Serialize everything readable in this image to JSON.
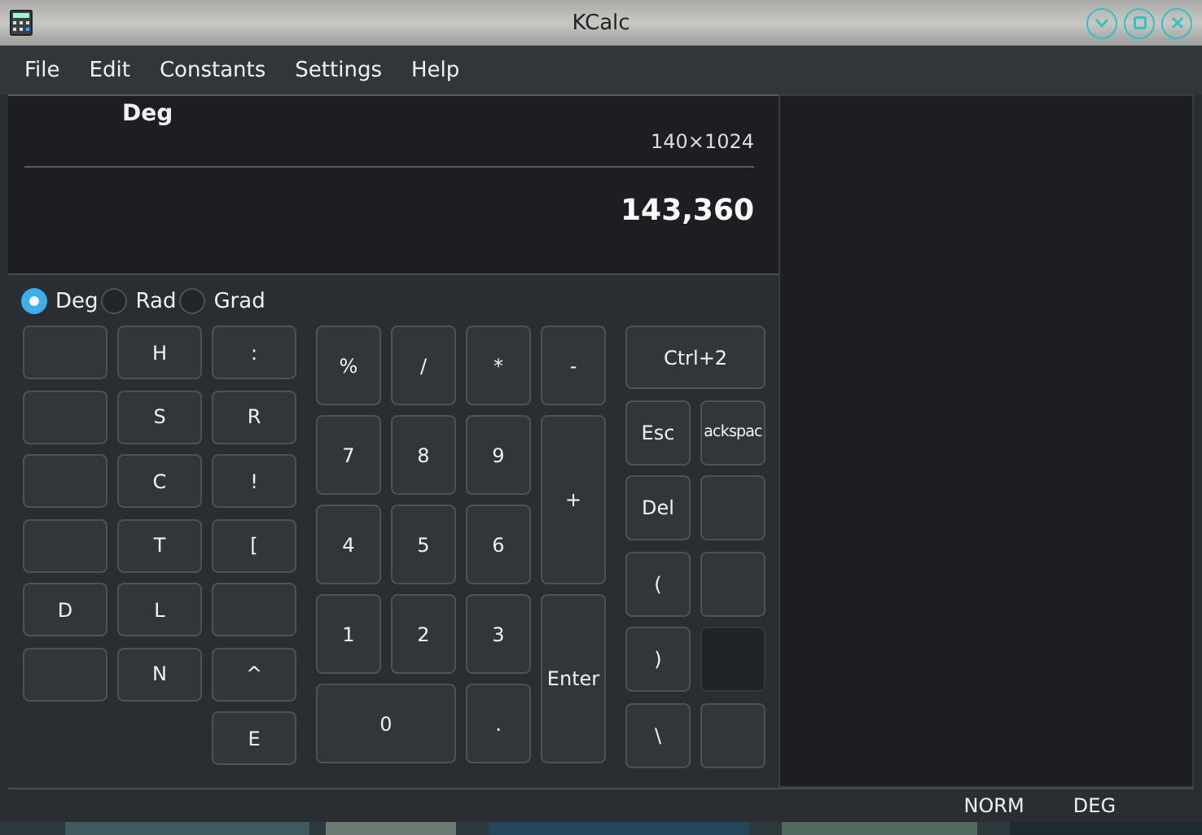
{
  "window": {
    "title": "KCalc"
  },
  "menu": [
    "File",
    "Edit",
    "Constants",
    "Settings",
    "Help"
  ],
  "display": {
    "angle_mode": "Deg",
    "history": "140×1024",
    "result": "143,360"
  },
  "angle_options": [
    {
      "label": "Deg",
      "selected": true
    },
    {
      "label": "Rad",
      "selected": false
    },
    {
      "label": "Grad",
      "selected": false
    }
  ],
  "function_columns": [
    {
      "keys": [
        {
          "kind": "blank"
        },
        {
          "kind": "blank"
        },
        {
          "kind": "blank"
        },
        {
          "kind": "blank"
        },
        {
          "kind": "normal",
          "label": "D"
        },
        {
          "kind": "blank"
        }
      ]
    },
    {
      "keys": [
        {
          "kind": "normal",
          "label": "H"
        },
        {
          "kind": "normal",
          "label": "S"
        },
        {
          "kind": "normal",
          "label": "C"
        },
        {
          "kind": "normal",
          "label": "T"
        },
        {
          "kind": "normal",
          "label": "L"
        },
        {
          "kind": "normal",
          "label": "N"
        }
      ]
    },
    {
      "keys": [
        {
          "kind": "normal",
          "label": ":"
        },
        {
          "kind": "normal",
          "label": "R"
        },
        {
          "kind": "normal",
          "label": "!"
        },
        {
          "kind": "normal",
          "label": "["
        },
        {
          "kind": "blank"
        },
        {
          "kind": "normal",
          "label": "^"
        },
        {
          "kind": "normal",
          "label": "E"
        }
      ]
    }
  ],
  "numpad": [
    {
      "kind": "normal",
      "label": "%"
    },
    {
      "kind": "normal",
      "label": "/"
    },
    {
      "kind": "normal",
      "label": "*"
    },
    {
      "kind": "normal",
      "label": "-"
    },
    {
      "kind": "normal",
      "label": "7"
    },
    {
      "kind": "normal",
      "label": "8"
    },
    {
      "kind": "normal",
      "label": "9"
    },
    {
      "kind": "tall",
      "label": "+"
    },
    {
      "kind": "normal",
      "label": "4"
    },
    {
      "kind": "normal",
      "label": "5"
    },
    {
      "kind": "normal",
      "label": "6"
    },
    {
      "kind": "normal",
      "label": "1"
    },
    {
      "kind": "normal",
      "label": "2"
    },
    {
      "kind": "normal",
      "label": "3"
    },
    {
      "kind": "tall",
      "label": "Enter"
    },
    {
      "kind": "wide",
      "label": "0"
    },
    {
      "kind": "normal",
      "label": "."
    }
  ],
  "edit_keys": [
    {
      "kind": "wide",
      "label": "Ctrl+2",
      "disabled": false
    },
    {
      "kind": "normal",
      "label": "Esc",
      "disabled": false
    },
    {
      "kind": "narrow",
      "label": "ackspac",
      "disabled": false
    },
    {
      "kind": "normal",
      "label": "Del",
      "disabled": false
    },
    {
      "kind": "blank",
      "disabled": false
    },
    {
      "kind": "normal",
      "label": "(",
      "disabled": false
    },
    {
      "kind": "blank",
      "disabled": false
    },
    {
      "kind": "normal",
      "label": ")",
      "disabled": false
    },
    {
      "kind": "blank",
      "disabled": true
    },
    {
      "kind": "normal",
      "label": "\\",
      "disabled": false
    },
    {
      "kind": "blank",
      "disabled": false
    }
  ],
  "status_bar": [
    "NORM",
    "DEG"
  ]
}
